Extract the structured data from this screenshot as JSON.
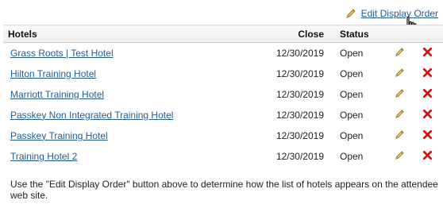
{
  "toolbar": {
    "edit_display_order_label": "Edit Display Order"
  },
  "table": {
    "columns": {
      "hotels": "Hotels",
      "close": "Close",
      "status": "Status"
    },
    "rows": [
      {
        "name": "Grass Roots | Test Hotel",
        "close": "12/30/2019",
        "status": "Open"
      },
      {
        "name": "Hilton Training Hotel",
        "close": "12/30/2019",
        "status": "Open"
      },
      {
        "name": "Marriott Training Hotel",
        "close": "12/30/2019",
        "status": "Open"
      },
      {
        "name": "Passkey Non Integrated Training Hotel",
        "close": "12/30/2019",
        "status": "Open"
      },
      {
        "name": "Passkey Training Hotel",
        "close": "12/30/2019",
        "status": "Open"
      },
      {
        "name": "Training Hotel 2",
        "close": "12/30/2019",
        "status": "Open"
      }
    ]
  },
  "footnote": "Use the \"Edit Display Order\" button above to determine how the list of hotels appears on the attendee web site.",
  "icons": {
    "edit": "pencil-icon",
    "delete": "delete-x-icon",
    "cursor": "hand-cursor-icon"
  },
  "colors": {
    "link": "#1f5d99",
    "delete_red": "#cc1111",
    "pencil_yellow": "#e8b84a"
  }
}
